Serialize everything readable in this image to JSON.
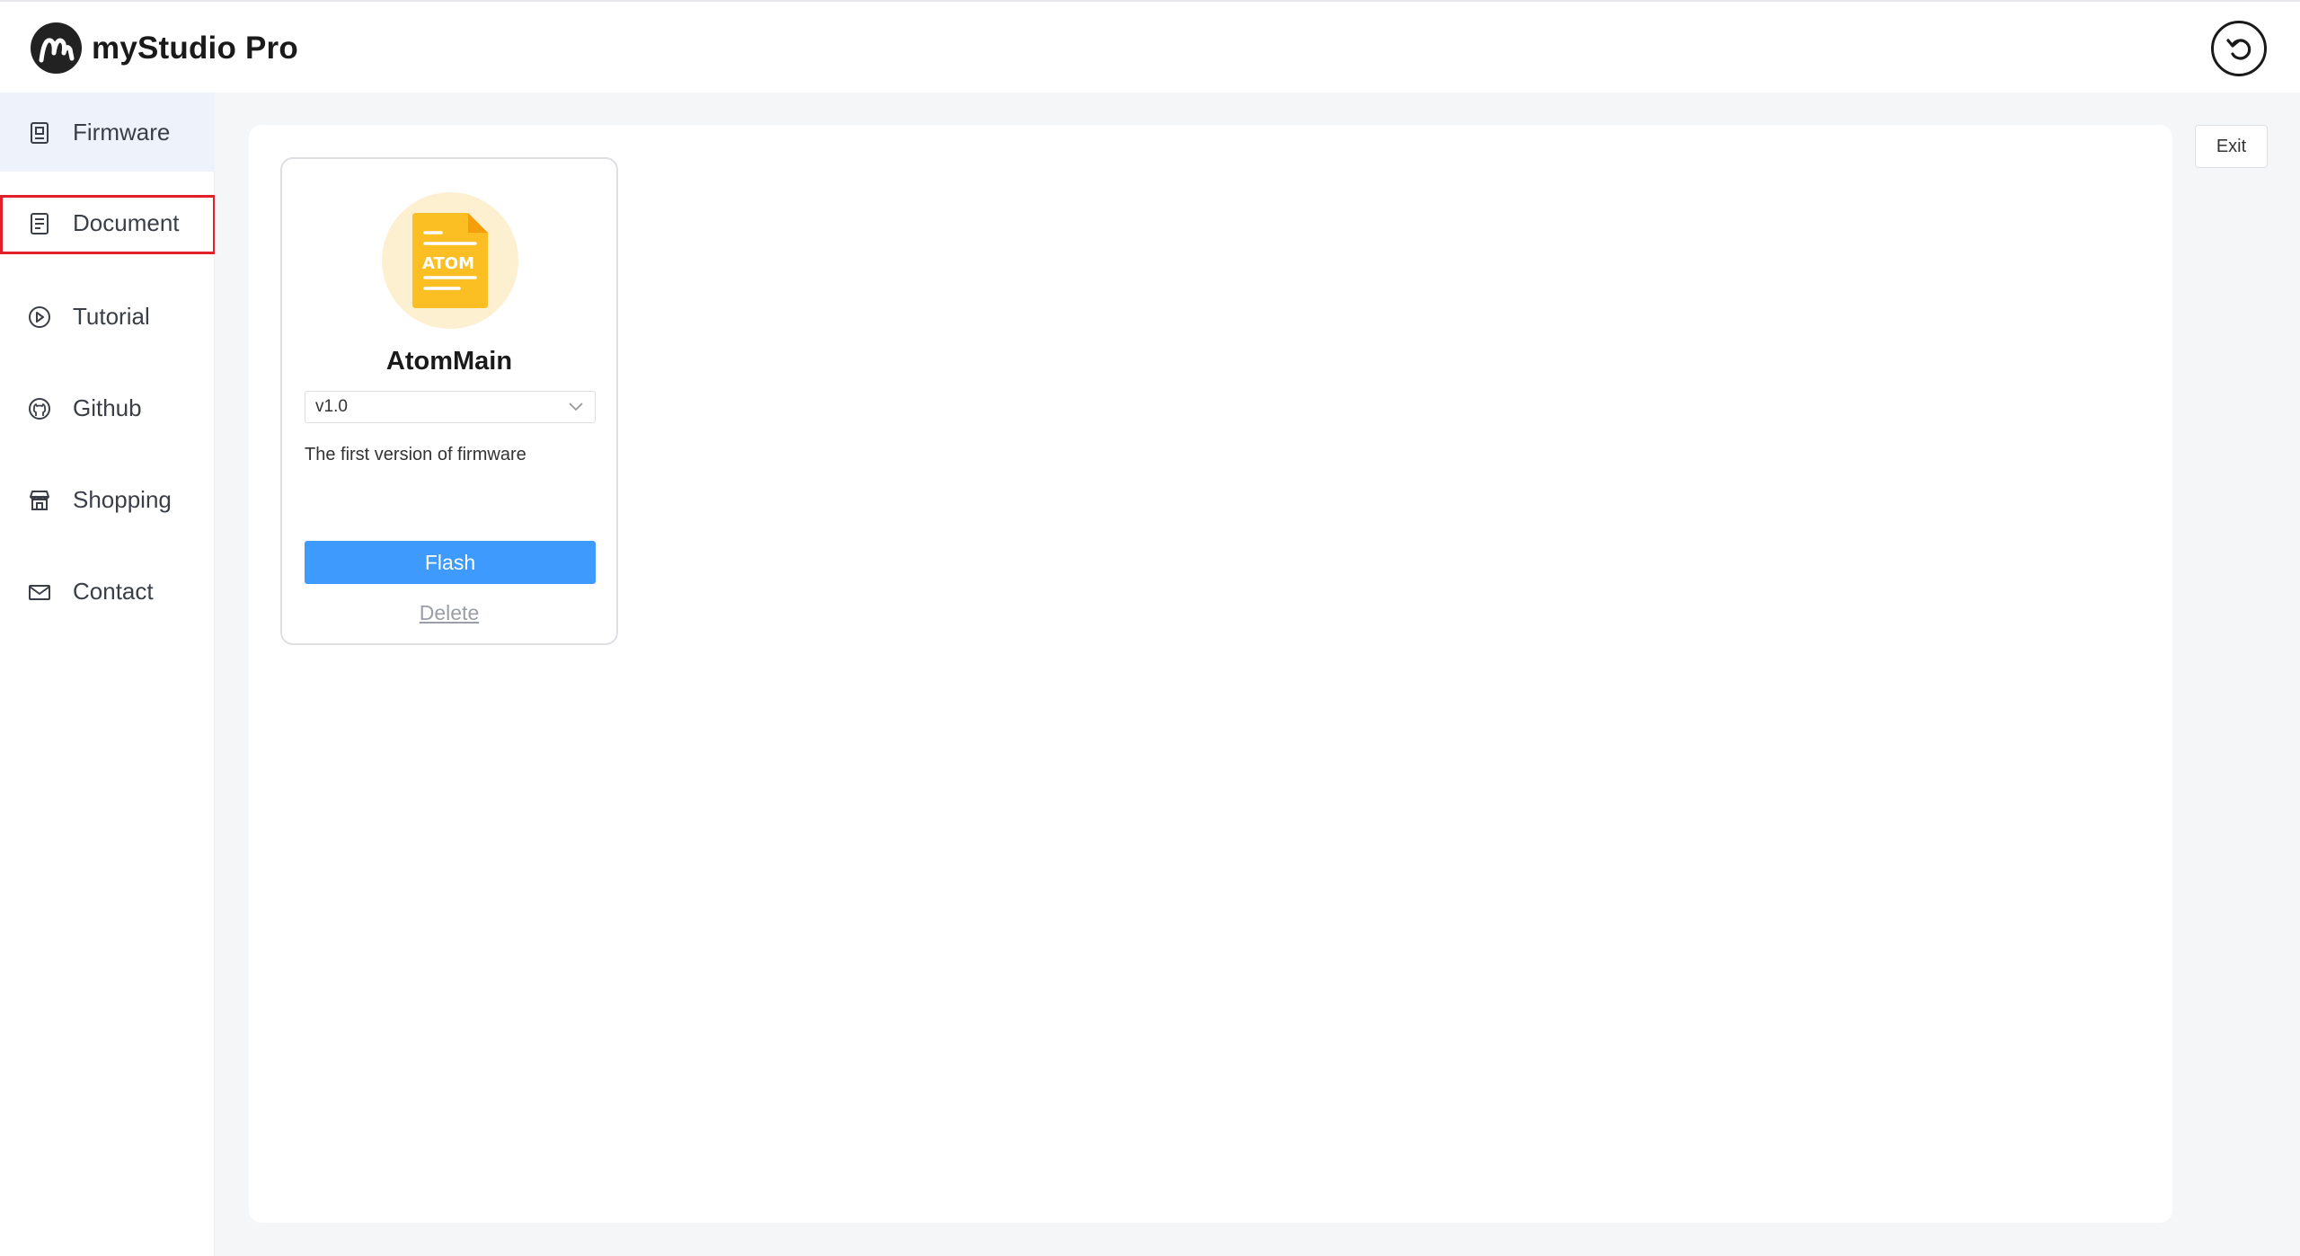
{
  "app": {
    "title": "myStudio Pro",
    "logo_icon": "mystudio-m-logo-icon",
    "back_icon": "undo-arrow-icon"
  },
  "sidebar": {
    "items": [
      {
        "label": "Firmware",
        "icon": "firmware-chip-icon",
        "active": true
      },
      {
        "label": "Document",
        "icon": "document-icon",
        "highlighted": true
      },
      {
        "label": "Tutorial",
        "icon": "play-circle-icon"
      },
      {
        "label": "Github",
        "icon": "github-icon"
      },
      {
        "label": "Shopping",
        "icon": "shop-icon"
      },
      {
        "label": "Contact",
        "icon": "mail-icon"
      }
    ]
  },
  "main": {
    "exit_label": "Exit",
    "card": {
      "icon": "atom-file-icon",
      "icon_text": "ATOM",
      "title": "AtomMain",
      "version": "v1.0",
      "description": "The first version of firmware",
      "flash_label": "Flash",
      "delete_label": "Delete"
    }
  },
  "colors": {
    "accent": "#3f9afe",
    "active_nav_bg": "#eef2fb",
    "highlight_border": "#e0202b",
    "file_icon": "#fbbf24"
  }
}
